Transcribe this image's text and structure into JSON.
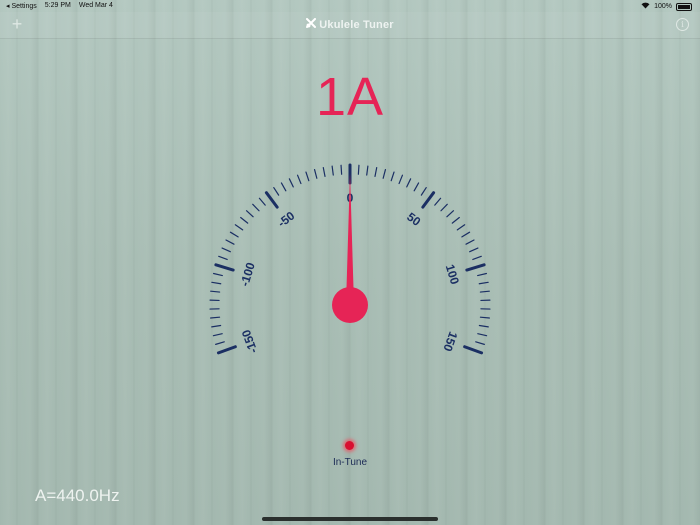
{
  "status_bar": {
    "carrier": "◂ Settings",
    "time": "5:29 PM",
    "date": "Wed Mar 4",
    "battery": "100%"
  },
  "nav": {
    "title": "Ukulele Tuner",
    "add_label": "+",
    "info_label": "i"
  },
  "tuner": {
    "note": "1A",
    "cents_offset": 0,
    "scale_labels": [
      "-150",
      "-100",
      "-50",
      "0",
      "50",
      "100",
      "150"
    ],
    "status_label": "In-Tune",
    "reference_frequency": "A=440.0Hz"
  },
  "colors": {
    "accent": "#e62456",
    "scale": "#1b2f63",
    "background": "#a9bfb6"
  }
}
